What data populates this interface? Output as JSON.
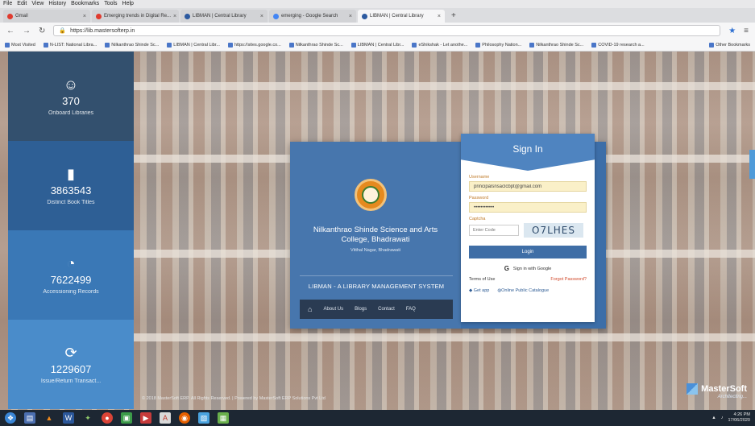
{
  "browser": {
    "menu": [
      "File",
      "Edit",
      "View",
      "History",
      "Bookmarks",
      "Tools",
      "Help"
    ],
    "tabs": [
      {
        "label": "Gmail",
        "active": false
      },
      {
        "label": "Emerging trends in Digital Re...",
        "active": false
      },
      {
        "label": "LIBMAN | Central Library",
        "active": false
      },
      {
        "label": "emerging - Google Search",
        "active": false
      },
      {
        "label": "LIBMAN | Central Library",
        "active": true
      }
    ],
    "new_tab": "+",
    "url": "https://lib.mastersofterp.in",
    "bookmarks": [
      "Most Visited",
      "N-LIST: National Libra...",
      "Nilkanthrao Shinde Sc...",
      "LIBMAN | Central Libr...",
      "https://sites.google.co...",
      "Nilkanthrao Shinde Sc...",
      "LIBMAN | Central Libr...",
      "eShikshak - Let anothe...",
      "Philosophy Nation...",
      "Nilkanthrao Shinde Sc...",
      "COVID-19 research a..."
    ],
    "other_bookmarks": "Other Bookmarks"
  },
  "stats": [
    {
      "icon": "☺",
      "icon_name": "smiley-icon",
      "value": "370",
      "label": "Onboard Libraries"
    },
    {
      "icon": "▮",
      "icon_name": "book-icon",
      "value": "3863543",
      "label": "Distinct Book Titles"
    },
    {
      "icon": "◔",
      "icon_name": "pie-chart-icon",
      "value": "7622499",
      "label": "Accessioning Records"
    },
    {
      "icon": "⟳",
      "icon_name": "refresh-icon",
      "value": "1229607",
      "label": "Issue/Return Transact..."
    }
  ],
  "college": {
    "name": "Nilkanthrao Shinde Science and Arts College, Bhadrawati",
    "address": "Vitthal Nagar, Bhadrawati",
    "system_name": "LIBMAN - A LIBRARY MANAGEMENT SYSTEM",
    "nav": [
      "About Us",
      "Blogs",
      "Contact",
      "FAQ"
    ]
  },
  "signin": {
    "title": "Sign In",
    "username_label": "Username",
    "username_value": "principalsnsaclcbpt@gmail.com",
    "password_label": "Password",
    "password_value": "••••••••••••",
    "captcha_label": "Captcha",
    "captcha_placeholder": "Enter Code",
    "captcha_code": "O7LHES",
    "login_label": "Login",
    "google_label": "Sign in with Google",
    "terms": "Terms of Use",
    "forgot": "Forgot Password?",
    "get_app": "Get app",
    "opac": "Online Public Catalogue"
  },
  "footer": {
    "copyright": "© 2018 MasterSoft ERP. All Rights Reserved.  |  Powered by MasterSoft ERP Solutions Pvt Ltd"
  },
  "brand": {
    "name": "MasterSoft",
    "tagline": "Architecting..."
  },
  "taskbar": {
    "time": "4:26 PM",
    "date": "17/06/2020"
  },
  "colors": {
    "stat1": "#33506e",
    "stat2": "#2e5f95",
    "stat3": "#3a78b6",
    "stat4": "#4a8cca",
    "card": "#3c6ea8",
    "accent": "#4f84c0"
  }
}
